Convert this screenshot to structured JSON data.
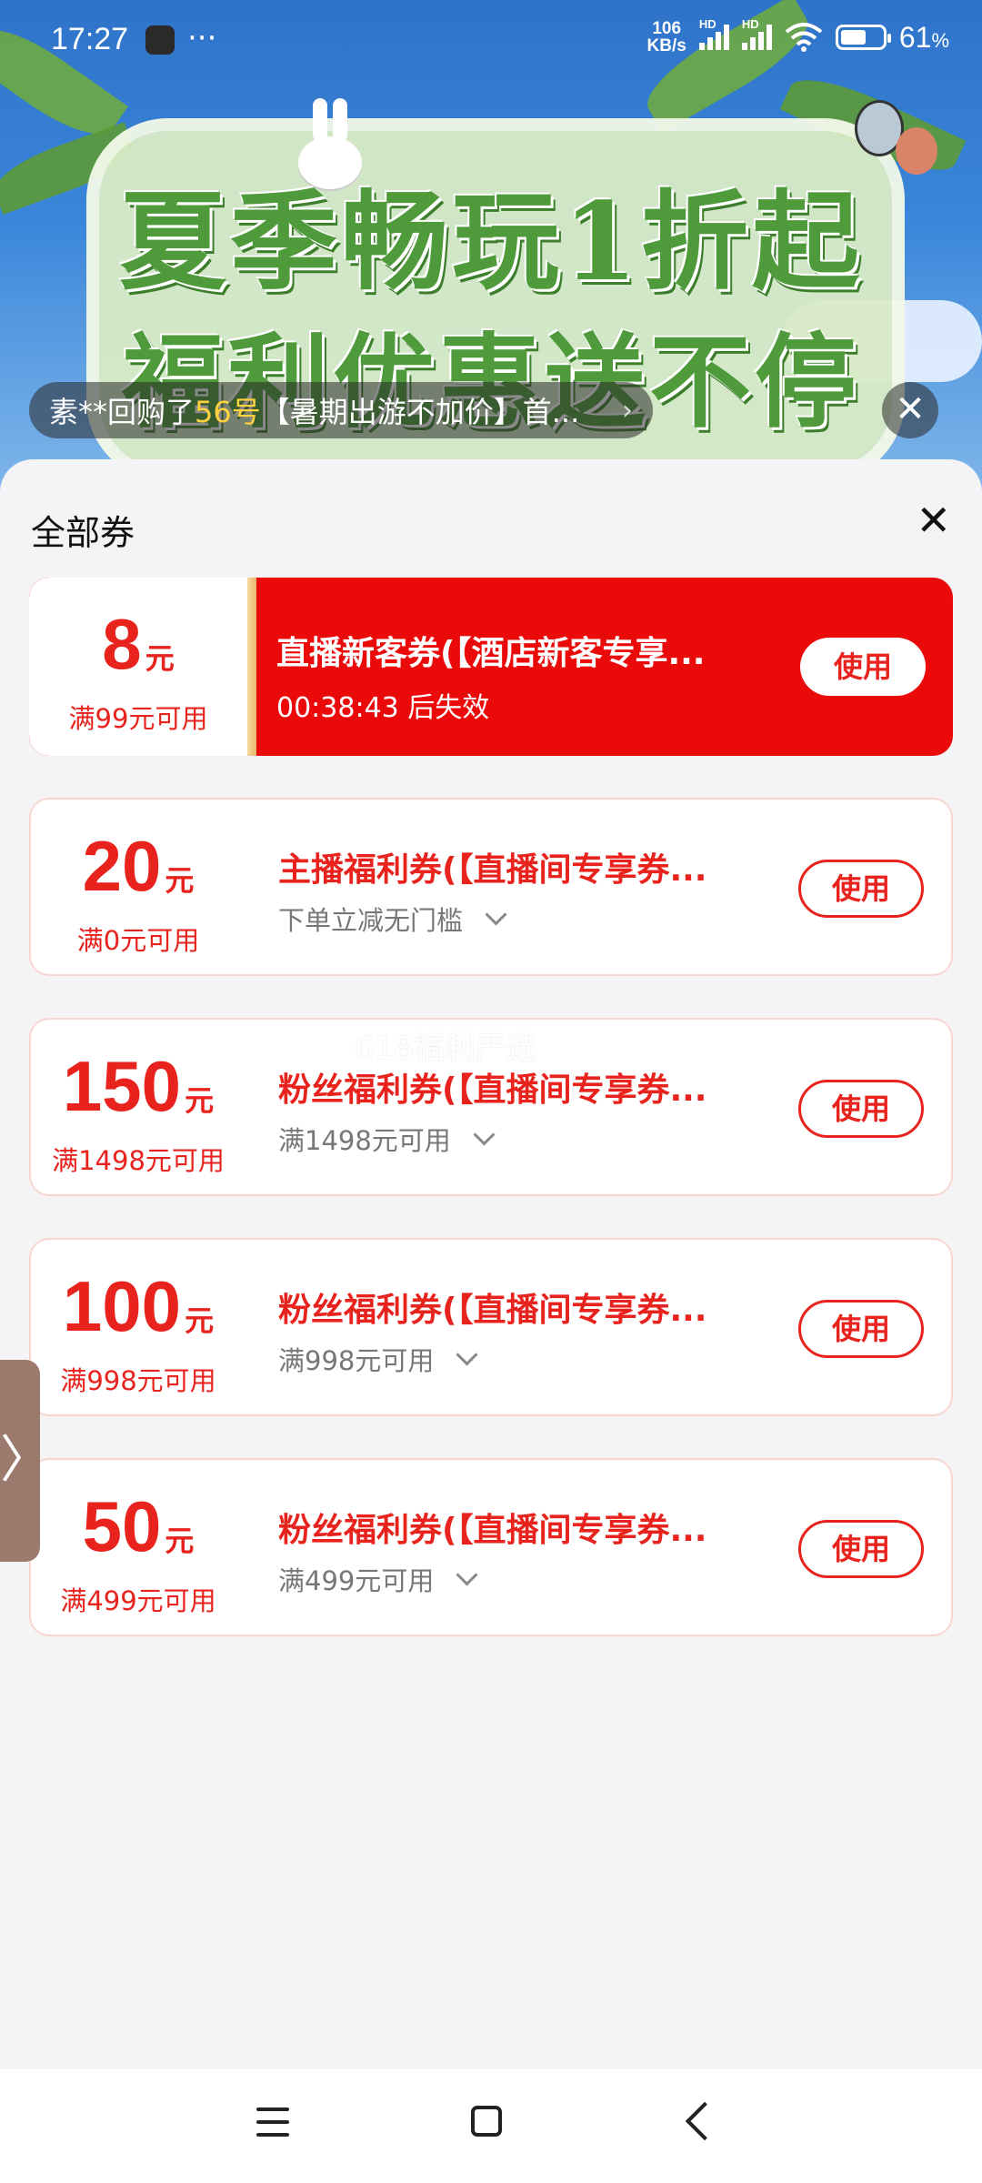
{
  "status_bar": {
    "time": "17:27",
    "dots": "···",
    "net_speed_value": "106",
    "net_speed_unit": "KB/s",
    "hd1": "HD",
    "hd2": "HD",
    "battery": "61",
    "battery_unit": "%",
    "battery_level": 0.61
  },
  "banner": {
    "line1": "夏季畅玩1折起",
    "line2": "福利优惠送不停"
  },
  "ticker": {
    "prefix": "素**回购了",
    "highlight": "56号",
    "suffix": "【暑期出游不加价】首...",
    "chevron": "›"
  },
  "sheet": {
    "title": "全部券",
    "close": "✕",
    "watermark": "618福利严选"
  },
  "coupons": [
    {
      "amount": "8",
      "unit": "元",
      "condition": "满99元可用",
      "title": "直播新客券(【酒店新客专享...",
      "subtitle": "00:38:43 后失效",
      "button": "使用"
    },
    {
      "amount": "20",
      "unit": "元",
      "condition": "满0元可用",
      "title": "主播福利券(【直播间专享券...",
      "subtitle": "下单立减无门槛",
      "button": "使用"
    },
    {
      "amount": "150",
      "unit": "元",
      "condition": "满1498元可用",
      "title": "粉丝福利券(【直播间专享券...",
      "subtitle": "满1498元可用",
      "button": "使用"
    },
    {
      "amount": "100",
      "unit": "元",
      "condition": "满998元可用",
      "title": "粉丝福利券(【直播间专享券...",
      "subtitle": "满998元可用",
      "button": "使用"
    },
    {
      "amount": "50",
      "unit": "元",
      "condition": "满499元可用",
      "title": "粉丝福利券(【直播间专享券...",
      "subtitle": "满499元可用",
      "button": "使用"
    }
  ],
  "side_tab": {
    "glyph": "〉"
  },
  "colors": {
    "accent": "#e8231d",
    "featured_bg": "#ea0a0a",
    "ticker_highlight": "#ffd23e"
  }
}
